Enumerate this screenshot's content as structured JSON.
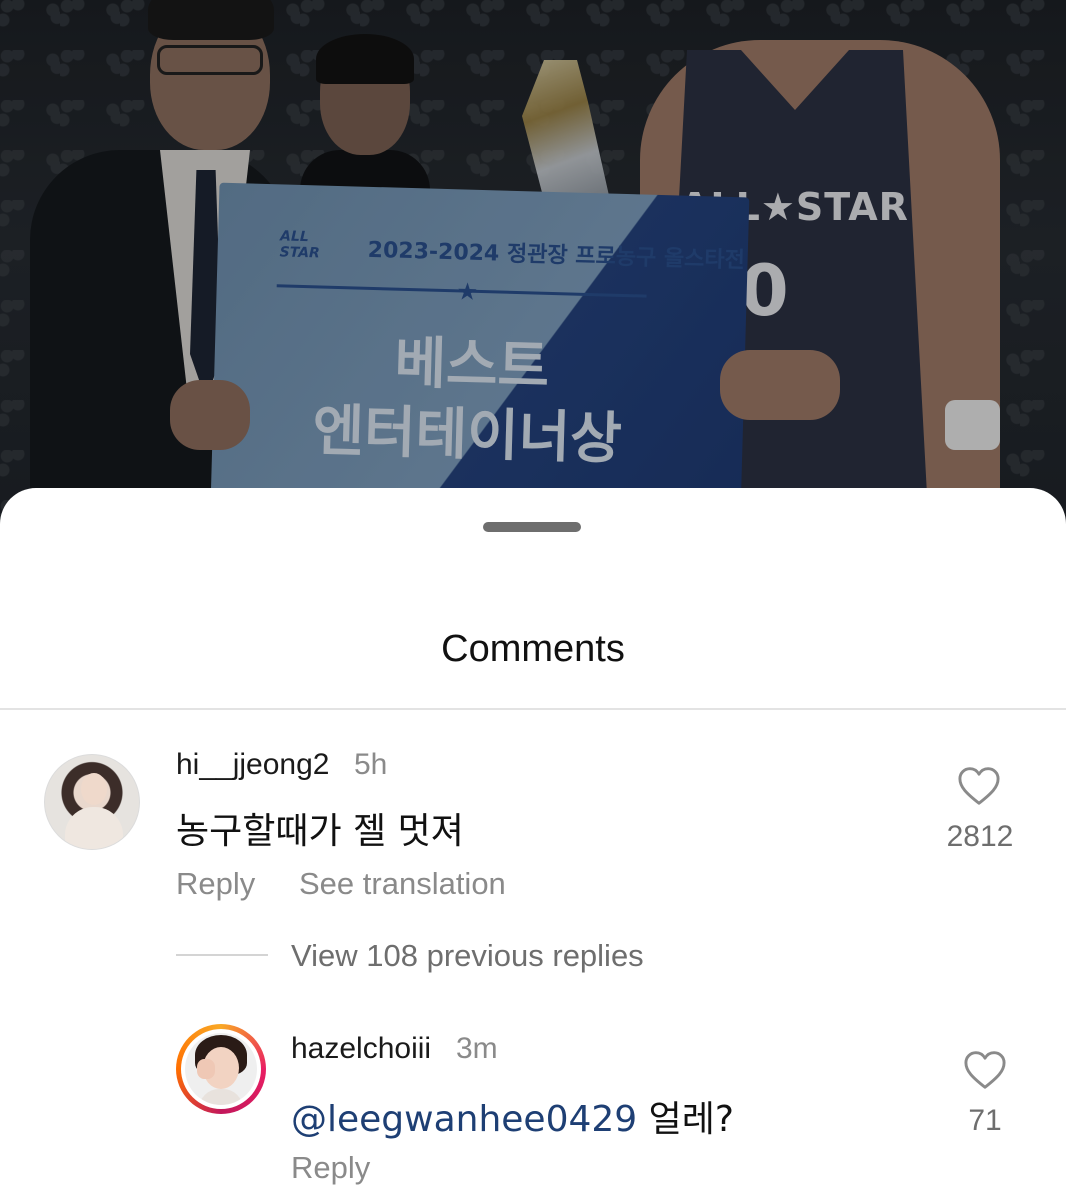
{
  "background_photo": {
    "sign_year_text": "2023-2024 정관장 프로농구 올스타전",
    "sign_logo_text": "ALL STAR",
    "sign_line1": "베스트",
    "sign_line2": "엔터테이너상",
    "jersey_text": "ALL★STAR",
    "jersey_number": "0"
  },
  "sheet": {
    "title": "Comments"
  },
  "comments": [
    {
      "username": "hi__jjeong2",
      "time": "5h",
      "text": "농구할때가 젤 멋져",
      "reply_label": "Reply",
      "translate_label": "See translation",
      "likes": "2812",
      "view_replies_label": "View 108 previous replies"
    },
    {
      "username": "hazelchoiii",
      "time": "3m",
      "mention": "@leegwanhee0429",
      "text": " 얼레?",
      "reply_label": "Reply",
      "likes": "71"
    }
  ],
  "icons": {
    "like": "heart-outline-icon",
    "handle": "drag-handle"
  },
  "colors": {
    "mention": "#1e3f74",
    "muted_text": "#8a8a8a",
    "story_ring_start": "#f9a825",
    "story_ring_end": "#e91e63"
  }
}
